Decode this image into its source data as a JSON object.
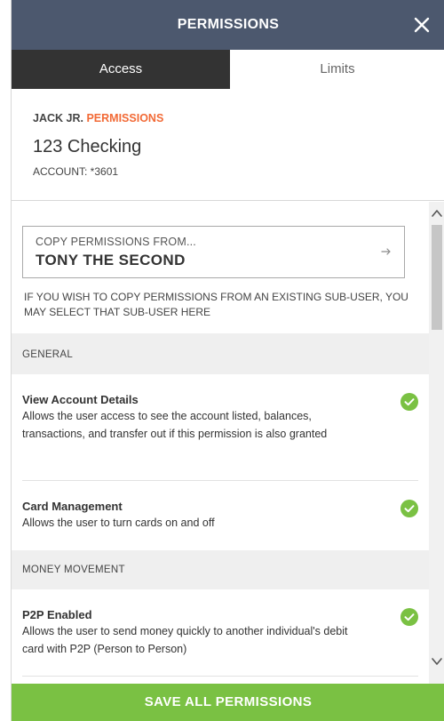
{
  "header": {
    "title": "PERMISSIONS",
    "close_icon": "close-icon"
  },
  "tabs": [
    {
      "label": "Access",
      "active": true
    },
    {
      "label": "Limits",
      "active": false
    }
  ],
  "account": {
    "owner": "JACK JR.",
    "owner_suffix": "PERMISSIONS",
    "name": "123 Checking",
    "number": "ACCOUNT: *3601"
  },
  "copy_permissions": {
    "caption": "COPY PERMISSIONS FROM...",
    "selected": "TONY THE SECOND",
    "note": "IF YOU WISH TO COPY PERMISSIONS FROM AN EXISTING SUB-USER, YOU MAY SELECT THAT SUB-USER HERE",
    "arrow_icon": "arrow-right-icon"
  },
  "sections": [
    {
      "title": "GENERAL",
      "permissions": [
        {
          "title": "View Account Details",
          "description": "Allows the user access to see the account listed, balances, transactions, and transfer out if this permission is also granted",
          "enabled": true
        },
        {
          "title": "Card Management",
          "description": "Allows the user to turn cards on and off",
          "enabled": true
        }
      ]
    },
    {
      "title": "MONEY MOVEMENT",
      "permissions": [
        {
          "title": "P2P Enabled",
          "description": "Allows the user to send money quickly to another individual's debit card with P2P (Person to Person)",
          "enabled": true
        }
      ]
    }
  ],
  "footer": {
    "save_label": "SAVE ALL PERMISSIONS"
  },
  "colors": {
    "header_bg": "#4c586e",
    "active_tab_bg": "#333333",
    "accent": "#f26a36",
    "check_green": "#7ac143",
    "save_green": "#7ac143"
  }
}
